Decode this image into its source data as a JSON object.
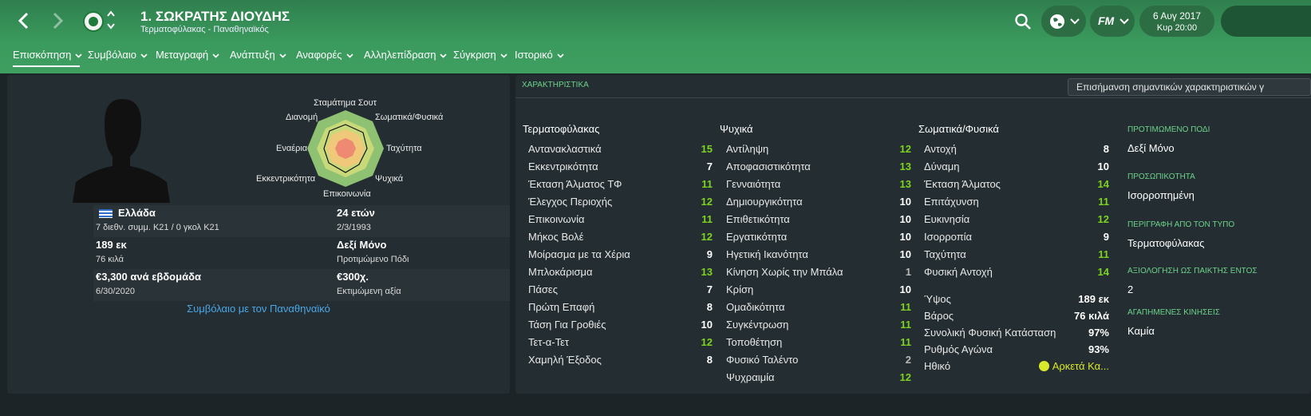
{
  "header": {
    "title": "1. ΣΩΚΡΑΤΗΣ ΔΙΟΥΔΗΣ",
    "subtitle": "Τερματοφύλακας - Παναθηναϊκός",
    "fm_label": "FM",
    "date_line1": "6 Αυγ 2017",
    "date_line2": "Κυρ 20:00"
  },
  "tabs": [
    {
      "label": "Επισκόπηση"
    },
    {
      "label": "Συμβόλαιο"
    },
    {
      "label": "Μεταγραφή"
    },
    {
      "label": "Ανάπτυξη"
    },
    {
      "label": "Αναφορές"
    },
    {
      "label": "Αλληλεπίδραση"
    },
    {
      "label": "Σύγκριση"
    },
    {
      "label": "Ιστορικό"
    }
  ],
  "profile": {
    "nation": "Ελλάδα",
    "caps": "7 διεθν. συμμ. Κ21 / 0 γκολ Κ21",
    "age": "24 ετών",
    "dob": "2/3/1993",
    "height": "189 εκ",
    "weight": "76 κιλά",
    "foot": "Δεξί Μόνο",
    "foot_label": "Προτιμώμενο Πόδι",
    "wage": "€3,300 ανά εβδομάδα",
    "contract_end": "6/30/2020",
    "value": "€300χ.",
    "value_label": "Εκτιμώμενη αξία",
    "contract_link": "Συμβόλαιο με τον Παναθηναϊκό"
  },
  "radar": {
    "labels": [
      "Σταμάτημα Σουτ",
      "Σωματικά/Φυσικά",
      "Ταχύτητα",
      "Ψυχικά",
      "Επικοινωνία",
      "Εκκεντρικότητα",
      "Εναέρια",
      "Διανομή"
    ]
  },
  "attributes": {
    "section_title": "ΧΑΡΑΚΤΗΡΙΣΤΙΚΑ",
    "highlight_button": "Επισήμανση σημαντικών χαρακτηριστικών γ",
    "goalkeeping": {
      "title": "Τερματοφύλακας",
      "items": [
        {
          "name": "Αντανακλαστικά",
          "value": "15"
        },
        {
          "name": "Εκκεντρικότητα",
          "value": "7"
        },
        {
          "name": "Έκταση Άλματος ΤΦ",
          "value": "11"
        },
        {
          "name": "Έλεγχος Περιοχής",
          "value": "12"
        },
        {
          "name": "Επικοινωνία",
          "value": "11"
        },
        {
          "name": "Μήκος Βολέ",
          "value": "12"
        },
        {
          "name": "Μοίρασμα με τα Χέρια",
          "value": "9"
        },
        {
          "name": "Μπλοκάρισμα",
          "value": "13"
        },
        {
          "name": "Πάσες",
          "value": "7"
        },
        {
          "name": "Πρώτη Επαφή",
          "value": "8"
        },
        {
          "name": "Τάση Για Γροθιές",
          "value": "10"
        },
        {
          "name": "Τετ-α-Τετ",
          "value": "12"
        },
        {
          "name": "Χαμηλή Έξοδος",
          "value": "8"
        }
      ]
    },
    "mental": {
      "title": "Ψυχικά",
      "items": [
        {
          "name": "Αντίληψη",
          "value": "12"
        },
        {
          "name": "Αποφασιστικότητα",
          "value": "13"
        },
        {
          "name": "Γενναιότητα",
          "value": "13"
        },
        {
          "name": "Δημιουργικότητα",
          "value": "10"
        },
        {
          "name": "Επιθετικότητα",
          "value": "10"
        },
        {
          "name": "Εργατικότητα",
          "value": "10"
        },
        {
          "name": "Ηγετική Ικανότητα",
          "value": "10"
        },
        {
          "name": "Κίνηση Χωρίς την Μπάλα",
          "value": "1"
        },
        {
          "name": "Κρίση",
          "value": "10"
        },
        {
          "name": "Ομαδικότητα",
          "value": "11"
        },
        {
          "name": "Συγκέντρωση",
          "value": "11"
        },
        {
          "name": "Τοποθέτηση",
          "value": "11"
        },
        {
          "name": "Φυσικό Ταλέντο",
          "value": "2"
        },
        {
          "name": "Ψυχραιμία",
          "value": "12"
        }
      ]
    },
    "physical": {
      "title": "Σωματικά/Φυσικά",
      "items": [
        {
          "name": "Αντοχή",
          "value": "8"
        },
        {
          "name": "Δύναμη",
          "value": "10"
        },
        {
          "name": "Έκταση Άλματος",
          "value": "14"
        },
        {
          "name": "Επιτάχυνση",
          "value": "11"
        },
        {
          "name": "Ευκινησία",
          "value": "12"
        },
        {
          "name": "Ισορροπία",
          "value": "9"
        },
        {
          "name": "Ταχύτητα",
          "value": "11"
        },
        {
          "name": "Φυσική Αντοχή",
          "value": "14"
        }
      ]
    },
    "stats": [
      {
        "name": "Ύψος",
        "value": "189 εκ"
      },
      {
        "name": "Βάρος",
        "value": "76 κιλά"
      },
      {
        "name": "Συνολική Φυσική Κατάσταση",
        "value": "97%"
      },
      {
        "name": "Ρυθμός Αγώνα",
        "value": "93%"
      },
      {
        "name": "Ηθικό",
        "value": "Αρκετά Κα..."
      }
    ]
  },
  "side": [
    {
      "key": "ΠΡΟΤΙΜΩΜΕΝΟ ΠΟΔΙ",
      "value": "Δεξί Μόνο"
    },
    {
      "key": "ΠΡΟΣΩΠΙΚΟΤΗΤΑ",
      "value": "Ισορροπημένη"
    },
    {
      "key": "ΠΕΡΙΓΡΑΦΗ ΑΠΟ ΤΟΝ ΤΥΠΟ",
      "value": "Τερματοφύλακας"
    },
    {
      "key": "ΑΞΙΟΛΟΓΗΣΗ ΩΣ ΠΑΙΚΤΗΣ ΕΝΤΟΣ",
      "value": "2"
    },
    {
      "key": "ΑΓΑΠΗΜΕΝΕΣ ΚΙΝΗΣΕΙΣ",
      "value": "Καμία"
    }
  ],
  "colors": {
    "accent": "#3f9f61",
    "positive": "#7ed321",
    "link": "#4aa8e8"
  }
}
